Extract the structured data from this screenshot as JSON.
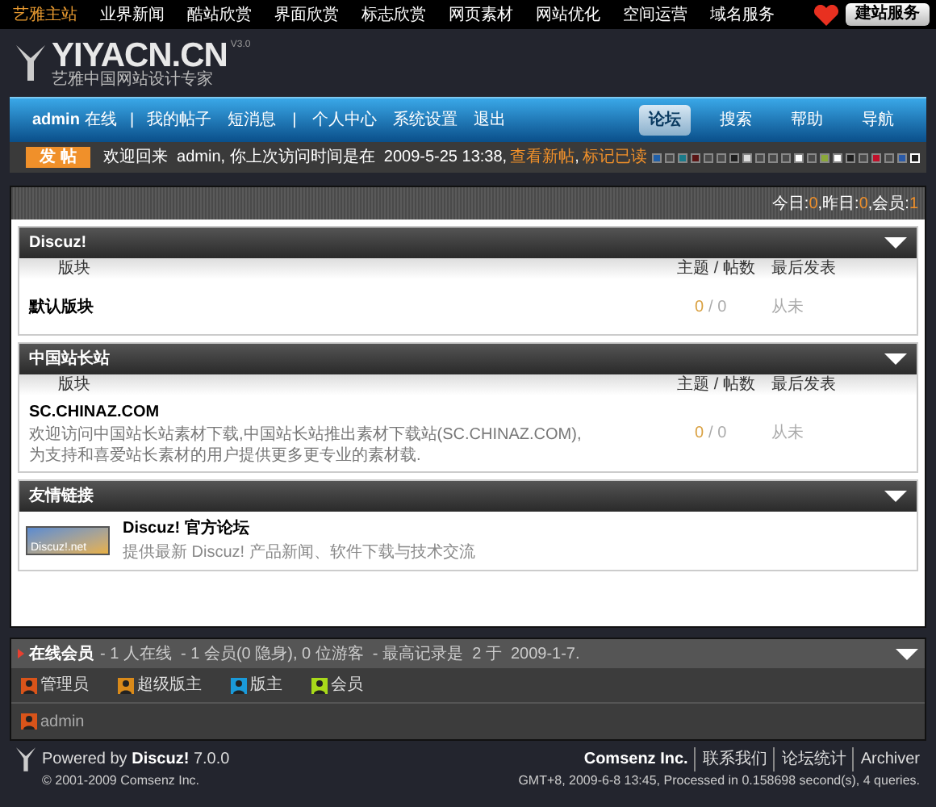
{
  "top_nav": [
    {
      "label": "艺雅主站",
      "selected": true
    },
    {
      "label": "业界新闻",
      "selected": false
    },
    {
      "label": "酷站欣赏",
      "selected": false
    },
    {
      "label": "界面欣赏",
      "selected": false
    },
    {
      "label": "标志欣赏",
      "selected": false
    },
    {
      "label": "网页素材",
      "selected": false
    },
    {
      "label": "网站优化",
      "selected": false
    },
    {
      "label": "空间运营",
      "selected": false
    },
    {
      "label": "域名服务",
      "selected": false
    }
  ],
  "service_button": "建站服务",
  "logo": {
    "name": "YIYACN.CN",
    "version": "V3.0",
    "tagline": "艺雅中国网站设计专家"
  },
  "user_menu": {
    "user": "admin",
    "status": "在线",
    "separator": "|",
    "items": [
      "我的帖子",
      "短消息",
      "|",
      "个人中心",
      "系统设置",
      "退出"
    ]
  },
  "main_nav": [
    {
      "label": "论坛",
      "selected": true
    },
    {
      "label": "搜索",
      "selected": false
    },
    {
      "label": "帮助",
      "selected": false
    },
    {
      "label": "导航",
      "selected": false
    }
  ],
  "post_button": "发 帖",
  "welcome": {
    "text": "欢迎回来  admin, 你上次访问时间是在  2009-5-25 13:38,",
    "links": [
      "查看新帖",
      "标记已读"
    ],
    "separator": ","
  },
  "styles": [
    {
      "color": "#1f5fa8",
      "selected": false
    },
    {
      "color": "#4a4a4a",
      "selected": false
    },
    {
      "color": "#1a7a8a",
      "selected": false
    },
    {
      "color": "#5a1414",
      "selected": false
    },
    {
      "color": "#4a4a4a",
      "selected": false
    },
    {
      "color": "#4a4a4a",
      "selected": false
    },
    {
      "color": "#1e1e1e",
      "selected": false
    },
    {
      "color": "#dddddd",
      "selected": false
    },
    {
      "color": "#4a4a4a",
      "selected": false
    },
    {
      "color": "#4a4a4a",
      "selected": false
    },
    {
      "color": "#4a4a4a",
      "selected": false
    },
    {
      "color": "#ffffff",
      "selected": false
    },
    {
      "color": "#4a4a4a",
      "selected": false
    },
    {
      "color": "#8aa83a",
      "selected": false
    },
    {
      "color": "#ffffff",
      "selected": false
    },
    {
      "color": "#1e1e1e",
      "selected": false
    },
    {
      "color": "#4a4a4a",
      "selected": false
    },
    {
      "color": "#c0102a",
      "selected": false
    },
    {
      "color": "#4a4a4a",
      "selected": false
    },
    {
      "color": "#2a5aa8",
      "selected": false
    },
    {
      "color": "#1e1e1e",
      "selected": true
    }
  ],
  "stats": [
    {
      "label": "今日:",
      "value": "0",
      "sep": ","
    },
    {
      "label": "昨日:",
      "value": "0",
      "sep": ","
    },
    {
      "label": "会员:",
      "value": "1"
    }
  ],
  "sections": [
    {
      "kind": "forums",
      "title": "Discuz!",
      "columns": [
        "版块",
        "主题 / 帖数",
        "最后发表"
      ],
      "forums": [
        {
          "name": "默认版块",
          "topics": "0",
          "separator": "/",
          "posts": "0",
          "last": "从未"
        }
      ]
    },
    {
      "kind": "forums",
      "title": "中国站长站",
      "columns": [
        "版块",
        "主题 / 帖数",
        "最后发表"
      ],
      "forums": [
        {
          "name": "SC.CHINAZ.COM",
          "description": "欢迎访问中国站长站素材下载,中国站长站推出素材下载站(SC.CHINAZ.COM),为支持和喜爱站长素材的用户提供更多更专业的素材载.",
          "topics": "0",
          "separator": "/",
          "posts": "0",
          "last": "从未"
        }
      ]
    },
    {
      "kind": "links",
      "title": "友情链接",
      "links": [
        {
          "logo": "Discuz!.net",
          "name": "Discuz! 官方论坛",
          "description": "提供最新 Discuz! 产品新闻、软件下载与技术交流"
        }
      ]
    }
  ],
  "online": {
    "title": "在线会员",
    "summary": "- 1 人在线  - 1 会员(0 隐身), 0 位游客  - 最高记录是  2 于  2009-1-7.",
    "roles": [
      {
        "label": "管理员",
        "color": "#d9541a"
      },
      {
        "label": "超级版主",
        "color": "#d98a1a"
      },
      {
        "label": "版主",
        "color": "#1a9ad9"
      },
      {
        "label": "会员",
        "color": "#a8d91a"
      }
    ],
    "users": [
      {
        "name": "admin",
        "color": "#d9541a"
      }
    ]
  },
  "footer": {
    "powered": "Powered by",
    "product": "Discuz!",
    "version": "7.0.0",
    "copyright": "© 2001-2009 Comsenz Inc.",
    "company": "Comsenz Inc.",
    "links": [
      "联系我们",
      "论坛统计",
      "Archiver"
    ],
    "info": "GMT+8, 2009-6-8 13:45, Processed in 0.158698 second(s), 4 queries."
  }
}
